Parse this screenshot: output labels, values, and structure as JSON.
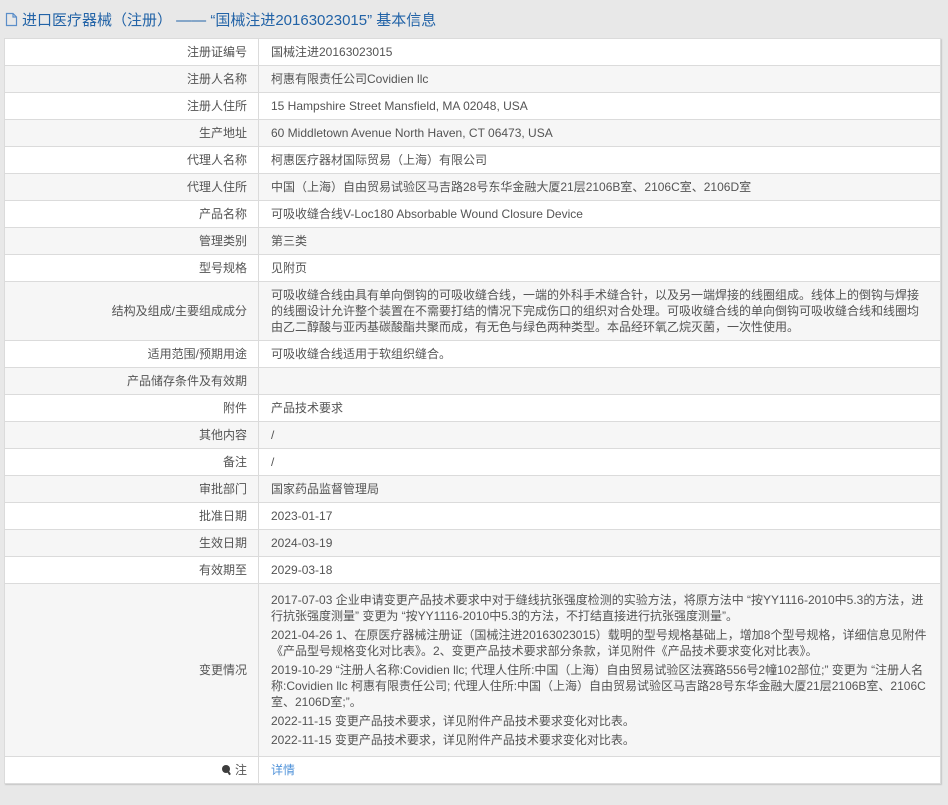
{
  "header": {
    "title": "进口医疗器械（注册） —— “国械注进20163023015” 基本信息"
  },
  "table": {
    "rows": [
      {
        "label": "注册证编号",
        "value": "国械注进20163023015"
      },
      {
        "label": "注册人名称",
        "value": "柯惠有限责任公司Covidien llc"
      },
      {
        "label": "注册人住所",
        "value": "15 Hampshire Street Mansfield, MA 02048, USA"
      },
      {
        "label": "生产地址",
        "value": "60 Middletown Avenue North Haven, CT 06473, USA"
      },
      {
        "label": "代理人名称",
        "value": "柯惠医疗器材国际贸易（上海）有限公司"
      },
      {
        "label": "代理人住所",
        "value": "中国（上海）自由贸易试验区马吉路28号东华金融大厦21层2106B室、2106C室、2106D室"
      },
      {
        "label": "产品名称",
        "value": "可吸收缝合线V-Loc180 Absorbable Wound Closure Device"
      },
      {
        "label": "管理类别",
        "value": "第三类"
      },
      {
        "label": "型号规格",
        "value": "见附页"
      },
      {
        "label": "结构及组成/主要组成成分",
        "value": "可吸收缝合线由具有单向倒钩的可吸收缝合线，一端的外科手术缝合针，以及另一端焊接的线圈组成。线体上的倒钩与焊接的线圈设计允许整个装置在不需要打结的情况下完成伤口的组织对合处理。可吸收缝合线的单向倒钩可吸收缝合线和线圈均由乙二醇酸与亚丙基碳酸酯共聚而成，有无色与绿色两种类型。本品经环氧乙烷灭菌，一次性使用。"
      },
      {
        "label": "适用范围/预期用途",
        "value": "可吸收缝合线适用于软组织缝合。"
      },
      {
        "label": "产品储存条件及有效期",
        "value": ""
      },
      {
        "label": "附件",
        "value": "产品技术要求"
      },
      {
        "label": "其他内容",
        "value": "/"
      },
      {
        "label": "备注",
        "value": "/"
      },
      {
        "label": "审批部门",
        "value": "国家药品监督管理局"
      },
      {
        "label": "批准日期",
        "value": "2023-01-17"
      },
      {
        "label": "生效日期",
        "value": "2024-03-19"
      },
      {
        "label": "有效期至",
        "value": "2029-03-18"
      },
      {
        "label": "变更情况",
        "entries": [
          "2017-07-03 企业申请变更产品技术要求中对于缝线抗张强度检测的实验方法，将原方法中 “按YY1116-2010中5.3的方法，进行抗张强度测量” 变更为 “按YY1116-2010中5.3的方法，不打结直接进行抗张强度测量”。",
          "2021-04-26 1、在原医疗器械注册证（国械注进20163023015）载明的型号规格基础上，增加8个型号规格，详细信息见附件《产品型号规格变化对比表》。2、变更产品技术要求部分条款，详见附件《产品技术要求变化对比表》。",
          "2019-10-29 “注册人名称:Covidien llc; 代理人住所:中国（上海）自由贸易试验区法赛路556号2幢102部位;” 变更为 “注册人名称:Covidien llc 柯惠有限责任公司; 代理人住所:中国（上海）自由贸易试验区马吉路28号东华金融大厦21层2106B室、2106C室、2106D室;”。",
          "2022-11-15 变更产品技术要求，详见附件产品技术要求变化对比表。",
          "2022-11-15 变更产品技术要求，详见附件产品技术要求变化对比表。"
        ]
      },
      {
        "label": "注",
        "icon": "note-icon",
        "link": "详情"
      }
    ]
  },
  "colors": {
    "title_blue": "#2263a7",
    "link_blue": "#4f92d9",
    "row_stripe": "#f6f6f6",
    "page_background": "#e8e8e8",
    "table_border": "#dbdbdb",
    "text": "#545454"
  }
}
